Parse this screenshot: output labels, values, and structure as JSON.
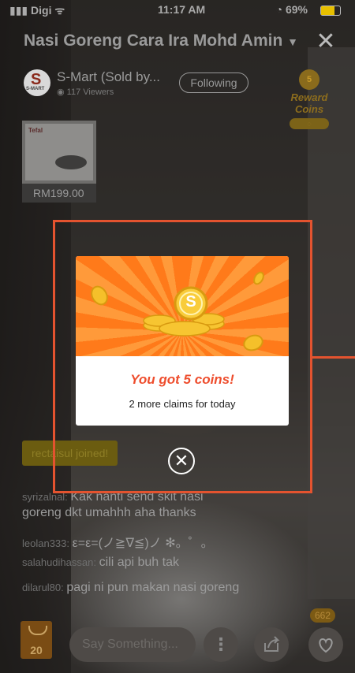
{
  "status_bar": {
    "carrier": "Digi",
    "time": "11:17 AM",
    "battery": "69%"
  },
  "stream": {
    "title": "Nasi Goreng Cara Ira Mohd Amin"
  },
  "shop": {
    "name": "S-Mart (Sold by...",
    "logo_letter": "S",
    "logo_text": "S-MART",
    "viewers": "117 Viewers",
    "follow_label": "Following"
  },
  "reward": {
    "coin_value": "5",
    "label": "Reward Coins"
  },
  "product": {
    "brand": "Tefal",
    "price": "RM199.00"
  },
  "modal": {
    "coin_symbol": "S",
    "title": "You got 5 coins!",
    "subtitle": "2 more claims for today"
  },
  "join_notice": "rectaisul joined!",
  "chat": [
    {
      "user": "syrizalnal:",
      "message": "Kak nanti send skit nasi"
    },
    {
      "user": "",
      "message": "goreng dkt umahhh aha thanks"
    },
    {
      "user": "leolan333:",
      "message": "ε=ε=(ノ≧∇≦)ノ ✻。゜。"
    },
    {
      "user": "salahudihassan:",
      "message": "cili api buh tak"
    },
    {
      "user": "dilarul80:",
      "message": "pagi ni pun makan nasi goreng"
    }
  ],
  "bottom": {
    "cart_count": "20",
    "say_placeholder": "Say Something...",
    "like_count": "662"
  },
  "colors": {
    "accent": "#ee4d2d",
    "highlight": "#e4532f"
  }
}
